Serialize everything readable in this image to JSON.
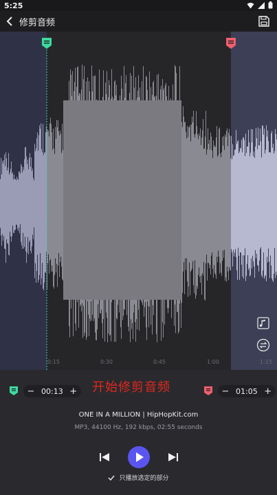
{
  "status": {
    "time": "5:25"
  },
  "appbar": {
    "title": "修剪音频",
    "back_icon": "back-arrow-icon",
    "save_icon": "save-icon"
  },
  "timeline": {
    "ticks": [
      "0:15",
      "0:30",
      "0:45",
      "1:00",
      "1:15"
    ]
  },
  "markers": {
    "start": {
      "value": "00:13",
      "color": "#3ddaa0",
      "icon": "start-marker-icon"
    },
    "end": {
      "value": "01:05",
      "color": "#ef5f6e",
      "icon": "end-marker-icon"
    },
    "minus": "−",
    "plus": "+"
  },
  "overlay": {
    "text": "开始修剪音频"
  },
  "track": {
    "title": "ONE IN A MILLION | HipHopKit.com",
    "meta": "MP3, 44100 Hz, 192 kbps, 02:55 seconds"
  },
  "player": {
    "only_selected_label": "只播放选定的部分",
    "accent": "#5a55f0"
  }
}
